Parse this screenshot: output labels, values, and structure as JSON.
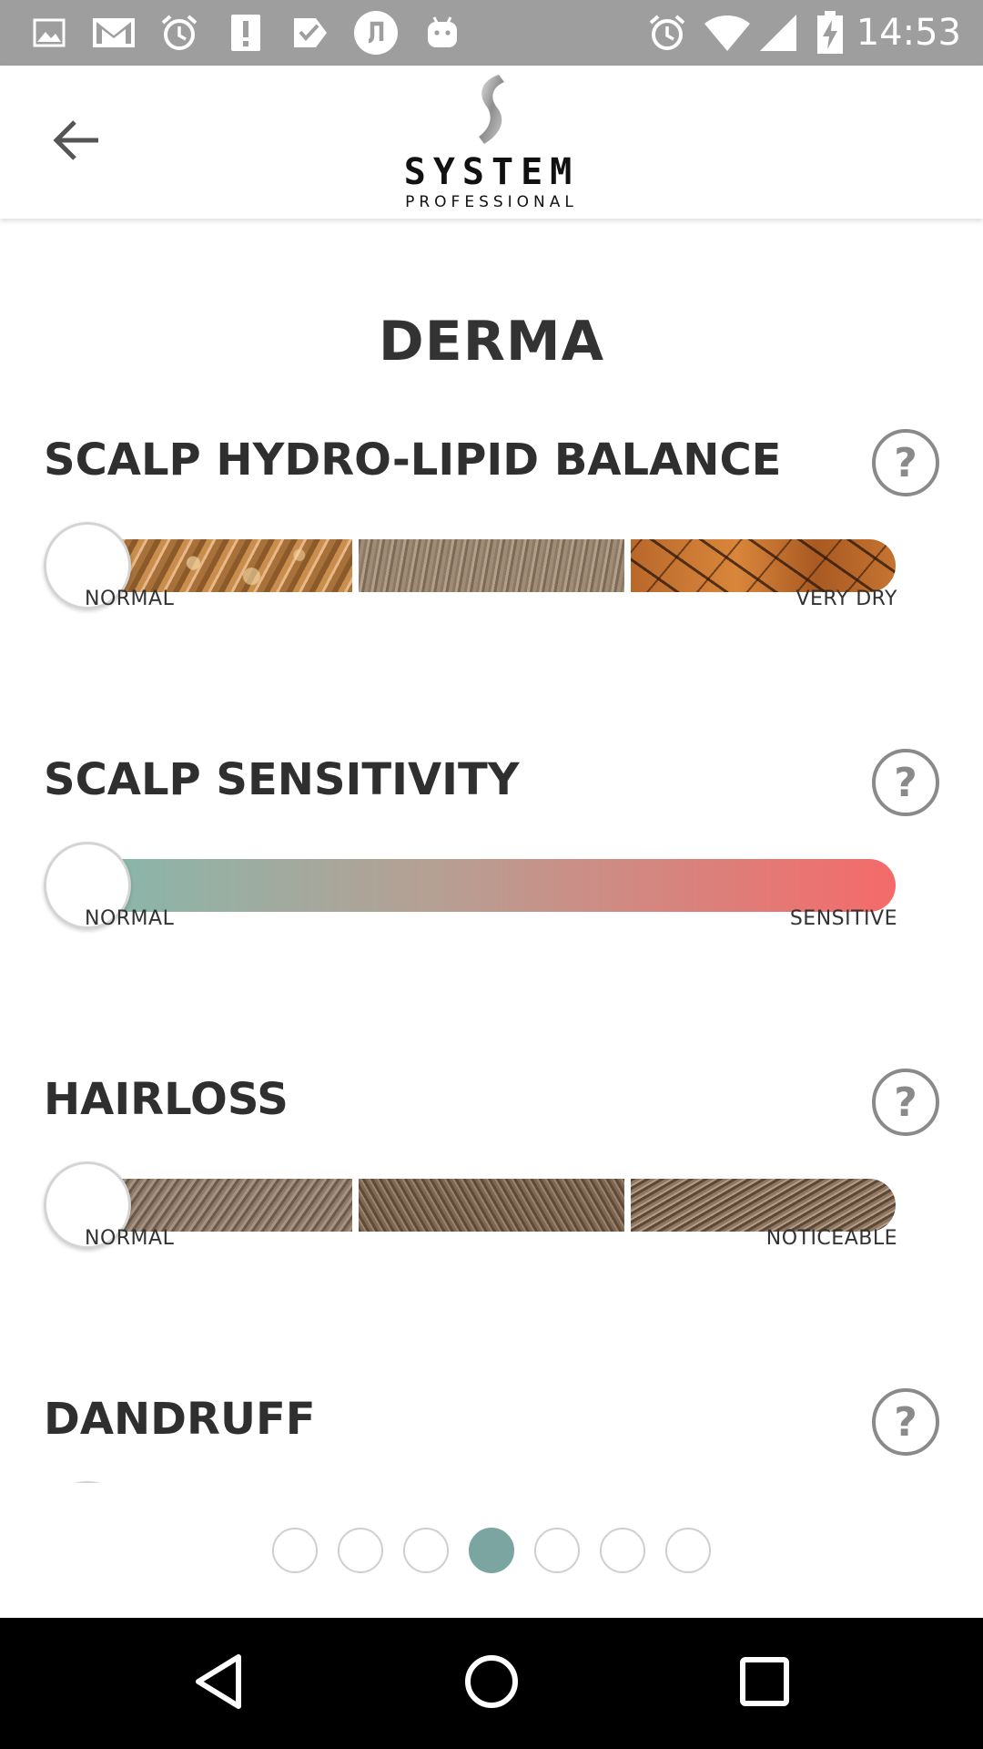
{
  "status_bar": {
    "time": "14:53",
    "left_icons": [
      "gallery-icon",
      "gmail-icon",
      "alarm-icon",
      "alert-icon",
      "check-icon",
      "music-icon",
      "android-icon"
    ],
    "right_icons": [
      "alarm-icon",
      "wifi-icon",
      "cell-signal-icon",
      "battery-charging-icon"
    ]
  },
  "app_bar": {
    "back_icon": "arrow-left-icon",
    "logo_word": "SYSTEM",
    "logo_sub": "PROFESSIONAL"
  },
  "page": {
    "title": "DERMA"
  },
  "sections": [
    {
      "title": "SCALP HYDRO-LIPID BALANCE",
      "help": "?",
      "left_label": "NORMAL",
      "right_label": "VERY DRY",
      "value": 0,
      "track": "images"
    },
    {
      "title": "SCALP SENSITIVITY",
      "help": "?",
      "left_label": "NORMAL",
      "right_label": "SENSITIVE",
      "value": 0,
      "track": "gradient",
      "colors": {
        "start": "#86b8ac",
        "middle": "#b89e92",
        "end": "#f56a6a"
      }
    },
    {
      "title": "HAIRLOSS",
      "help": "?",
      "left_label": "NORMAL",
      "right_label": "NOTICEABLE",
      "value": 0,
      "track": "images"
    },
    {
      "title": "DANDRUFF",
      "help": "?"
    }
  ],
  "pager": {
    "total": 7,
    "active_index": 3,
    "active_color": "#7aa5a0"
  },
  "nav_bar": {
    "back_icon": "nav-back-icon",
    "home_icon": "nav-home-icon",
    "recents_icon": "nav-recents-icon"
  }
}
